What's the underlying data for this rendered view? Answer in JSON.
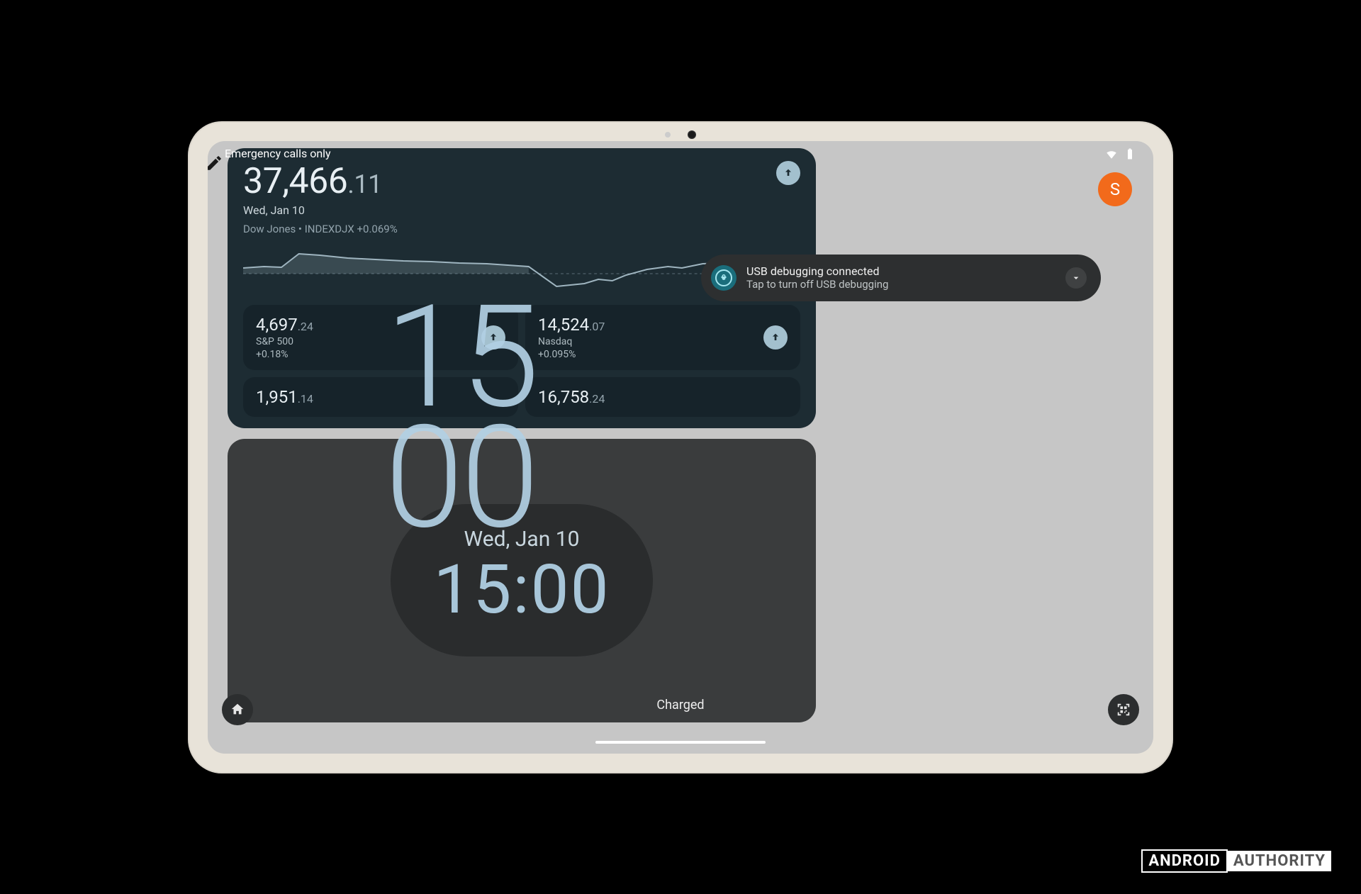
{
  "status": {
    "left": "Emergency calls only"
  },
  "avatar": {
    "letter": "S"
  },
  "stocks": {
    "main_whole": "37,466",
    "main_dec": ".11",
    "date": "Wed, Jan 10",
    "meta": "Dow Jones • INDEXDJX +0.069%",
    "cards": [
      {
        "whole": "4,697",
        "dec": ".24",
        "name": "S&P 500",
        "change": "+0.18%"
      },
      {
        "whole": "14,524",
        "dec": ".07",
        "name": "Nasdaq",
        "change": "+0.095%"
      },
      {
        "whole": "1,951",
        "dec": ".14",
        "name": "",
        "change": ""
      },
      {
        "whole": "16,758",
        "dec": ".24",
        "name": "",
        "change": ""
      }
    ]
  },
  "clock_widget": {
    "date": "Wed, Jan 10",
    "time": "15:00"
  },
  "lock_clock": {
    "hh": "15",
    "mm": "00"
  },
  "notification": {
    "title": "USB debugging connected",
    "subtitle": "Tap to turn off USB debugging"
  },
  "charged": "Charged",
  "watermark": {
    "a": "ANDROID",
    "b": "AUTHORITY"
  },
  "chart_data": {
    "type": "line",
    "title": "Dow Jones intraday",
    "x": [
      0,
      1,
      2,
      3,
      4,
      5,
      6,
      7,
      8,
      9,
      10,
      11,
      12,
      13,
      14,
      15,
      16,
      17,
      18,
      19,
      20,
      21,
      22,
      23,
      24,
      25,
      26,
      27,
      28,
      29
    ],
    "values": [
      50,
      52,
      51,
      68,
      66,
      62,
      60,
      58,
      57,
      55,
      54,
      52,
      50,
      40,
      20,
      22,
      24,
      30,
      28,
      35,
      45,
      50,
      48,
      55,
      56,
      44,
      40,
      42,
      50,
      52
    ],
    "baseline": 48,
    "ylabel": "",
    "xlabel": ""
  }
}
